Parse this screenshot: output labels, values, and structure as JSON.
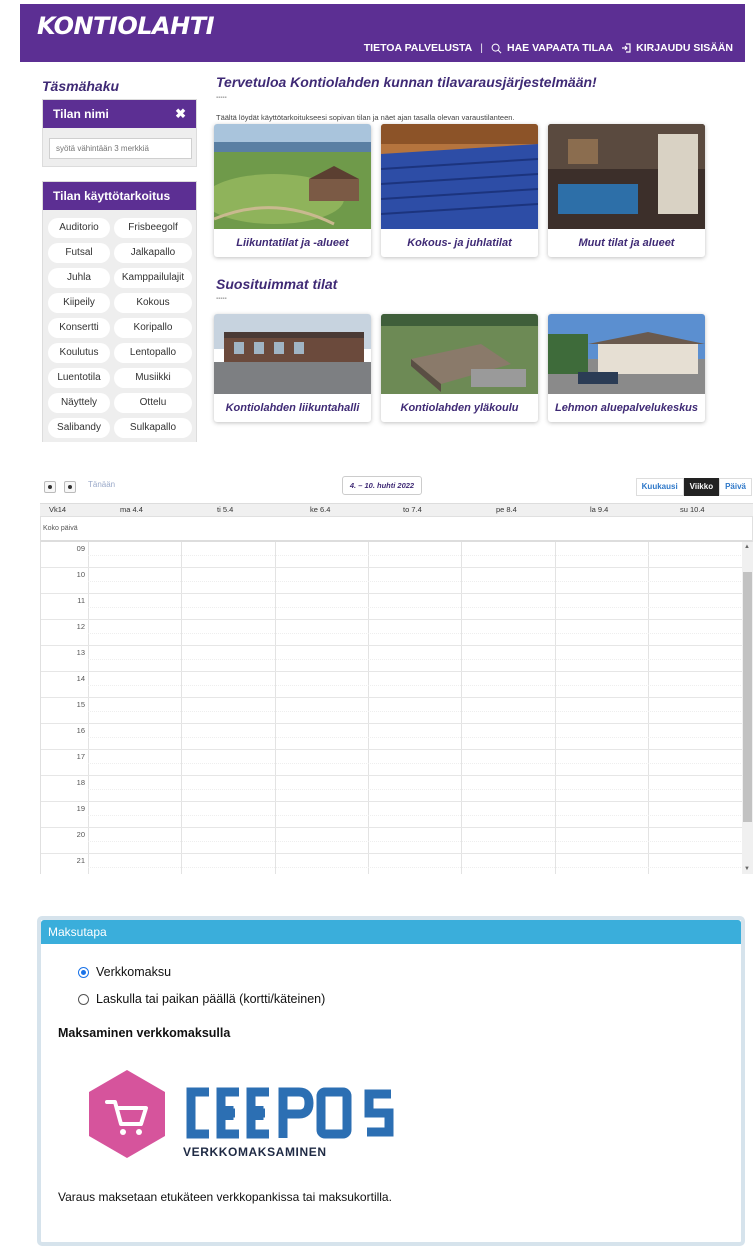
{
  "header": {
    "logo": "KONTIOLAHTI",
    "nav": {
      "about": "TIETOA PALVELUSTA",
      "separator": "|",
      "search": "HAE VAPAATA TILAA",
      "login": "KIRJAUDU SISÄÄN"
    }
  },
  "sidebar": {
    "title": "Täsmähaku",
    "name_panel": {
      "title": "Tilan nimi",
      "placeholder": "syötä vähintään 3 merkkiä"
    },
    "purpose_panel": {
      "title": "Tilan käyttötarkoitus",
      "chips": [
        "Auditorio",
        "Frisbeegolf",
        "Futsal",
        "Jalkapallo",
        "Juhla",
        "Kamppailulajit",
        "Kiipeily",
        "Kokous",
        "Konsertti",
        "Koripallo",
        "Koulutus",
        "Lentopallo",
        "Luentotila",
        "Musiikki",
        "Näyttely",
        "Ottelu",
        "Salibandy",
        "Sulkapallo"
      ]
    }
  },
  "main": {
    "welcome": "Tervetuloa Kontiolahden kunnan tilavarausjärjestelmään!",
    "intro": "Täältä löydät käyttötarkoitukseesi sopivan tilan ja näet ajan tasalla olevan varaustilanteen.",
    "dots": "▪▪▪▪▪",
    "categories": [
      "Liikuntatilat ja -alueet",
      "Kokous- ja juhlatilat",
      "Muut tilat ja alueet"
    ],
    "popular_title": "Suosituimmat tilat",
    "popular": [
      "Kontiolahden liikuntahalli",
      "Kontiolahden yläkoulu",
      "Lehmon aluepalvelukeskus"
    ]
  },
  "calendar": {
    "today_label": "Tänään",
    "date_range": "4. – 10. huhti 2022",
    "views": [
      "Kuukausi",
      "Viikko",
      "Päivä"
    ],
    "active_view": "Viikko",
    "week_label": "Vk14",
    "days": [
      "ma 4.4",
      "ti 5.4",
      "ke 6.4",
      "to 7.4",
      "pe 8.4",
      "la 9.4",
      "su 10.4"
    ],
    "all_day_label": "Koko päivä",
    "hours": [
      "09",
      "10",
      "11",
      "12",
      "13",
      "14",
      "15",
      "16",
      "17",
      "18",
      "19",
      "20",
      "21"
    ]
  },
  "payment": {
    "title": "Maksutapa",
    "options": [
      "Verkkomaksu",
      "Laskulla tai paikan päällä (kortti/käteinen)"
    ],
    "selected": "Verkkomaksu",
    "subtitle": "Maksaminen verkkomaksulla",
    "logo_text": "CEEPOS",
    "logo_tagline": "VERKKOMAKSAMINEN",
    "note": "Varaus maksetaan etukäteen verkkopankissa tai maksukortilla."
  },
  "colors": {
    "brand_purple": "#5c2f93",
    "heading_purple": "#3f2a75",
    "payment_header": "#3aaedb",
    "ceepos_pink": "#d6549c",
    "ceepos_blue": "#2c6fb3"
  }
}
